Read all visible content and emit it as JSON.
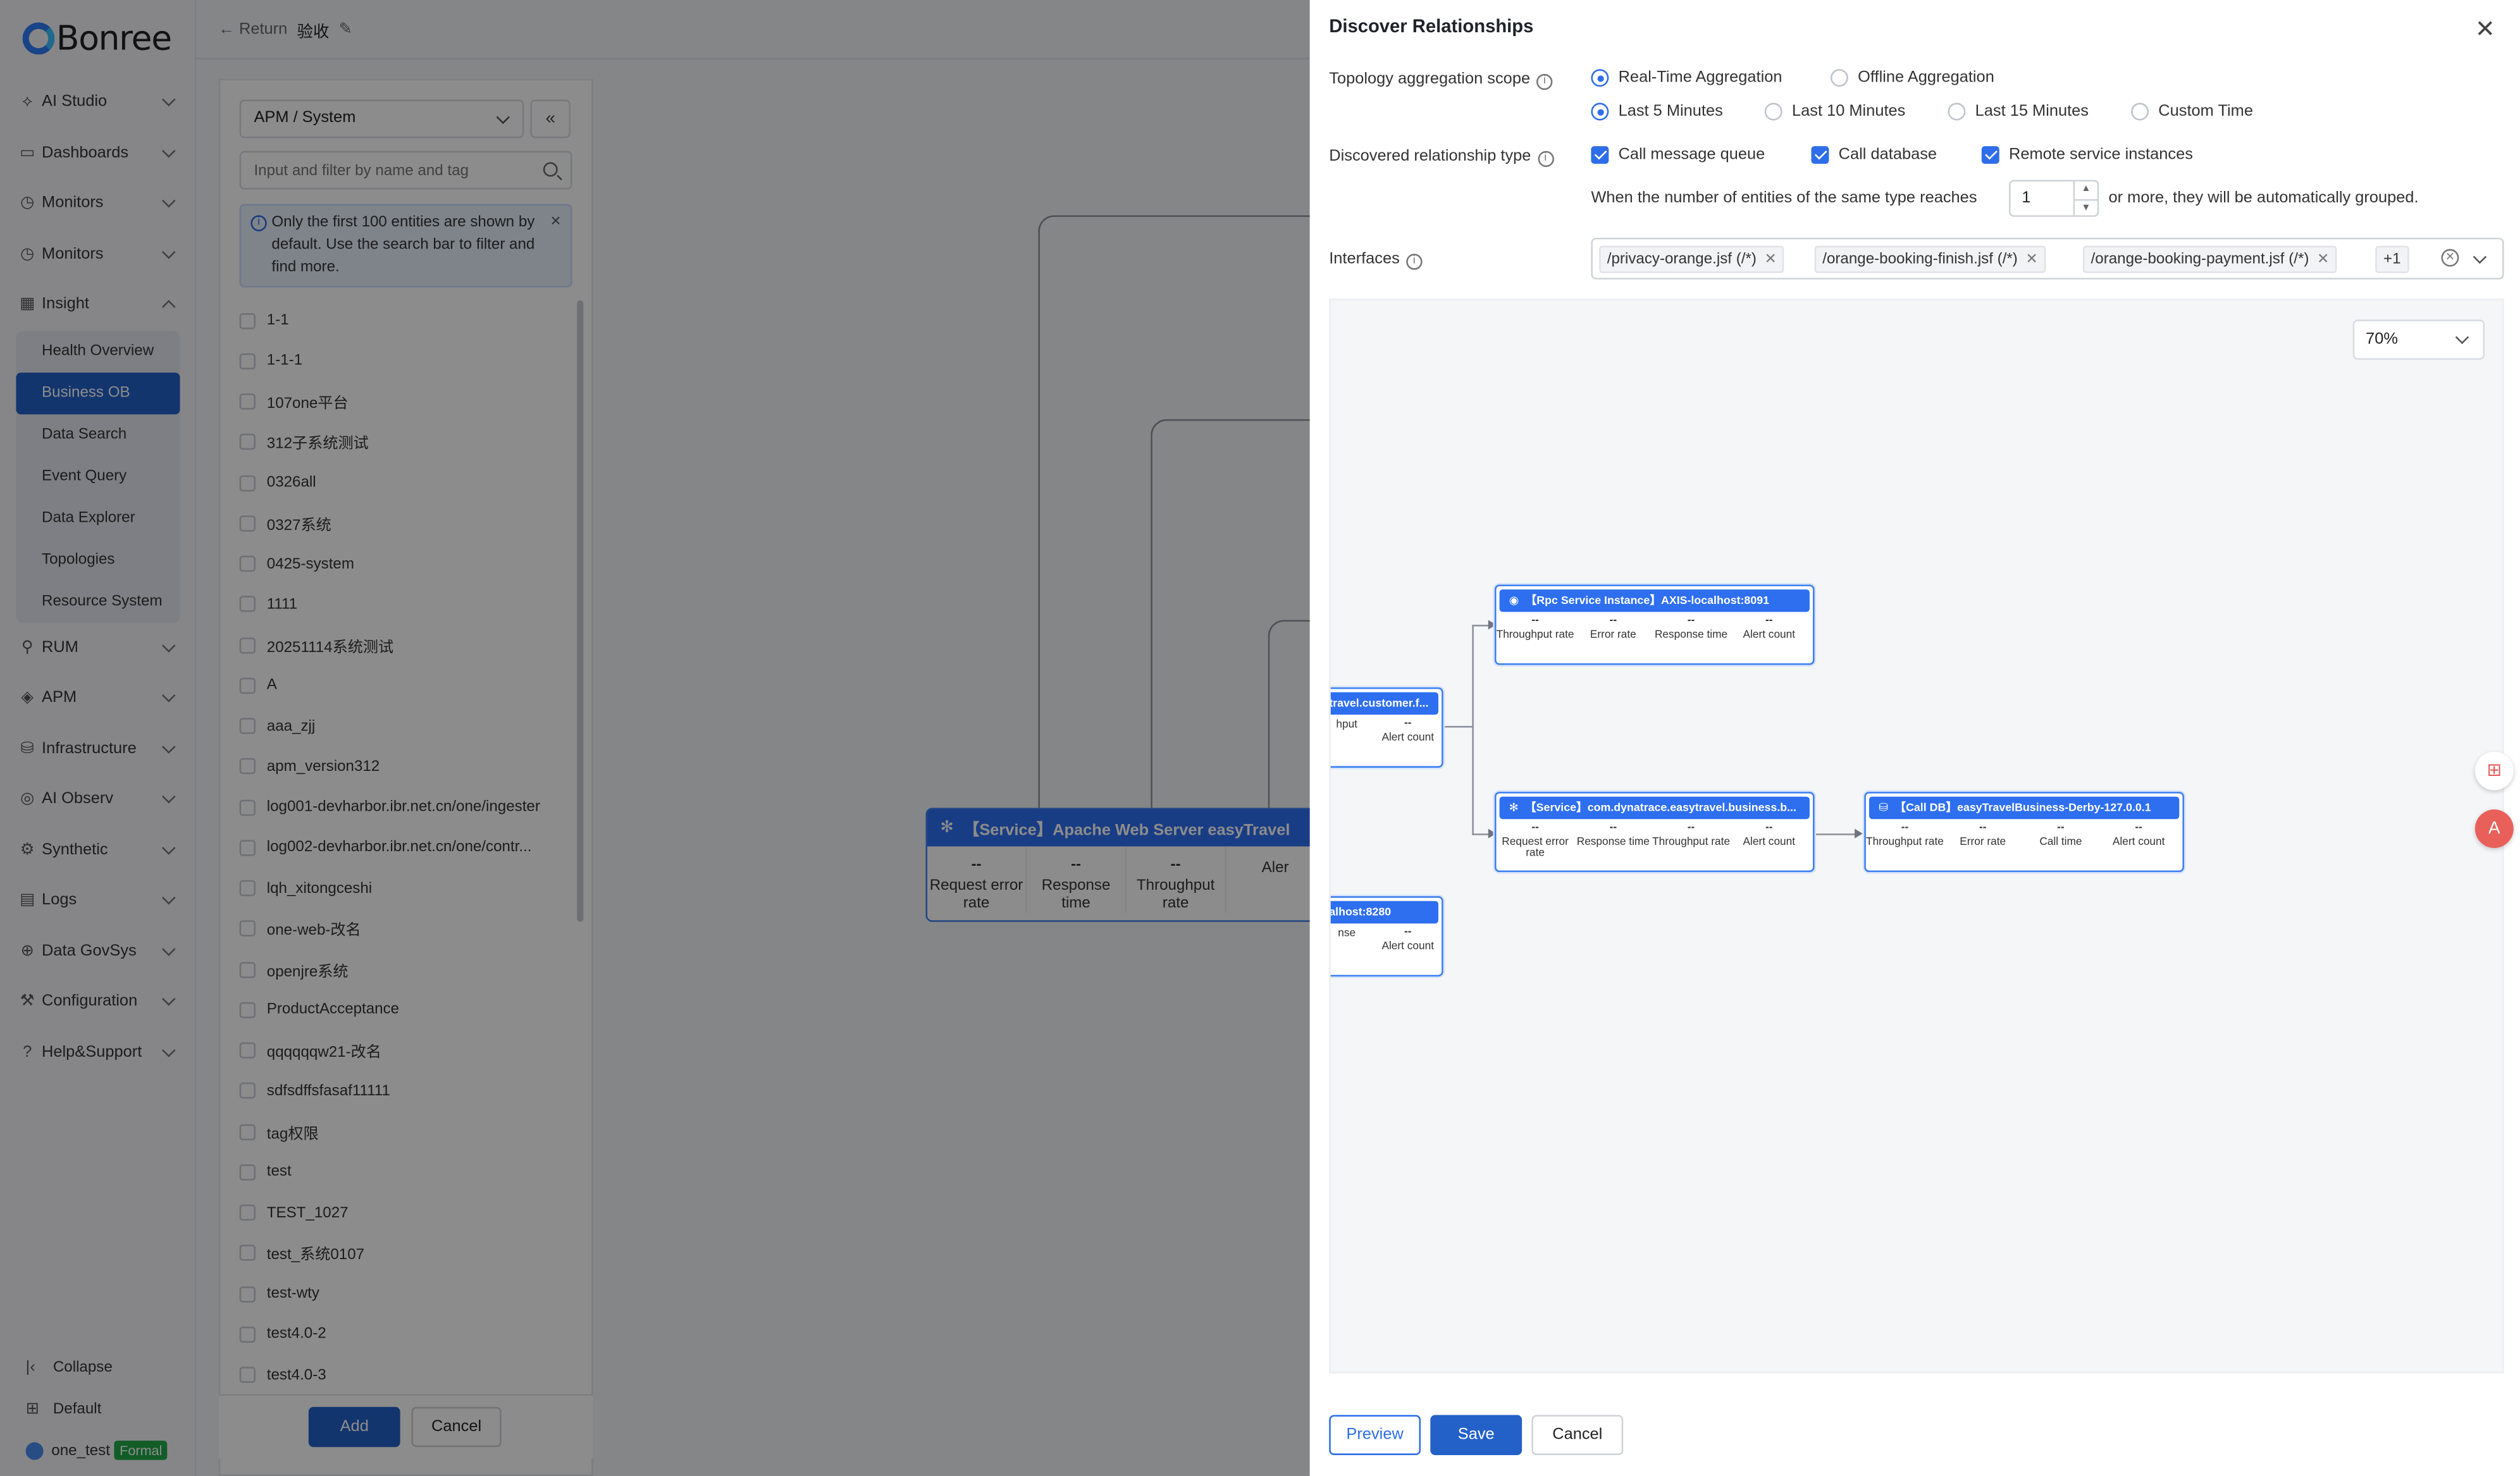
{
  "logo": {
    "text": "Bonree"
  },
  "sidebar": {
    "items": [
      {
        "label": "AI Studio",
        "icon": "ai-icon"
      },
      {
        "label": "Dashboards",
        "icon": "dashboard-icon"
      },
      {
        "label": "Monitors",
        "icon": "monitor-icon"
      },
      {
        "label": "Monitors",
        "icon": "monitor-icon"
      },
      {
        "label": "Insight",
        "icon": "insight-icon"
      }
    ],
    "insight_sub": [
      "Health Overview",
      "Business OB",
      "Data Search",
      "Event Query",
      "Data Explorer",
      "Topologies",
      "Resource System"
    ],
    "items_after": [
      {
        "label": "RUM",
        "icon": "rum-icon"
      },
      {
        "label": "APM",
        "icon": "apm-icon"
      },
      {
        "label": "Infrastructure",
        "icon": "infrastructure-icon"
      },
      {
        "label": "AI Observ",
        "icon": "ai-observ-icon"
      },
      {
        "label": "Synthetic",
        "icon": "synthetic-icon"
      },
      {
        "label": "Logs",
        "icon": "logs-icon"
      },
      {
        "label": "Data GovSys",
        "icon": "data-gov-icon"
      },
      {
        "label": "Configuration",
        "icon": "configuration-icon"
      },
      {
        "label": "Help&Support",
        "icon": "help-icon"
      }
    ],
    "collapse_label": "Collapse",
    "default_label": "Default",
    "user_name": "one_test",
    "user_badge": "Formal"
  },
  "topbar": {
    "return_label": "← Return",
    "title": "验收"
  },
  "left_panel": {
    "select_value": "APM / System",
    "search_placeholder": "Input and filter by name and tag",
    "info_text": "Only the first 100 entities are shown by default. Use the search bar to filter and find more.",
    "entities": [
      "1-1",
      "1-1-1",
      "107one平台",
      "312子系统测试",
      "0326all",
      "0327系统",
      "0425-system",
      "1111",
      "20251114系统测试",
      "A",
      "aaa_zjj",
      "apm_version312",
      "log001-devharbor.ibr.net.cn/one/ingester",
      "log002-devharbor.ibr.net.cn/one/contr...",
      "lqh_xitongceshi",
      "one-web-改名",
      "openjre系统",
      "ProductAcceptance",
      "qqqqqqw21-改名",
      "sdfsdffsfasaf11111",
      "tag权限",
      "test",
      "TEST_1027",
      "test_系统0107",
      "test-wty",
      "test4.0-2",
      "test4.0-3"
    ],
    "add_label": "Add",
    "cancel_label": "Cancel"
  },
  "bg_node": {
    "title": "【Service】Apache Web Server easyTravel",
    "cells": [
      {
        "value": "--",
        "label": "Request error rate"
      },
      {
        "value": "--",
        "label": "Response time"
      },
      {
        "value": "--",
        "label": "Throughput rate"
      },
      {
        "value": "",
        "label": "Aler"
      }
    ]
  },
  "drawer": {
    "title": "Discover Relationships",
    "scope_label": "Topology aggregation scope",
    "aggregation": [
      "Real-Time Aggregation",
      "Offline Aggregation"
    ],
    "aggregation_selected": 0,
    "time_ranges": [
      "Last 5 Minutes",
      "Last 10 Minutes",
      "Last 15 Minutes",
      "Custom Time"
    ],
    "time_selected": 0,
    "rel_type_label": "Discovered relationship type",
    "rel_types": [
      "Call message queue",
      "Call database",
      "Remote service instances"
    ],
    "group_text_before": "When the number of entities of the same type reaches",
    "group_value": "1",
    "group_text_after": "or more, they will be automatically grouped.",
    "interfaces_label": "Interfaces",
    "interfaces": [
      "/privacy-orange.jsf (/*)",
      "/orange-booking-finish.jsf (/*)",
      "/orange-booking-payment.jsf (/*)"
    ],
    "interfaces_more": "+1",
    "zoom": "70%",
    "preview_label": "Preview",
    "save_label": "Save",
    "cancel_label": "Cancel"
  },
  "topology": {
    "nodes": [
      {
        "name": "rpc-node",
        "title": "【Rpc Service Instance】AXIS-localhost:8091",
        "icon": "rpc-icon",
        "cells": [
          {
            "value": "--",
            "label": "Throughput rate"
          },
          {
            "value": "--",
            "label": "Error rate"
          },
          {
            "value": "--",
            "label": "Response time"
          },
          {
            "value": "--",
            "label": "Alert count"
          }
        ]
      },
      {
        "name": "service-node",
        "title": "【Service】com.dynatrace.easytravel.business.b...",
        "icon": "service-icon",
        "cells": [
          {
            "value": "--",
            "label": "Request error rate"
          },
          {
            "value": "--",
            "label": "Response time"
          },
          {
            "value": "--",
            "label": "Throughput rate"
          },
          {
            "value": "--",
            "label": "Alert count"
          }
        ]
      },
      {
        "name": "db-node",
        "title": "【Call DB】easyTravelBusiness-Derby-127.0.0.1",
        "icon": "database-icon",
        "cells": [
          {
            "value": "--",
            "label": "Throughput rate"
          },
          {
            "value": "--",
            "label": "Error rate"
          },
          {
            "value": "--",
            "label": "Call time"
          },
          {
            "value": "--",
            "label": "Alert count"
          }
        ]
      },
      {
        "name": "customer-node",
        "title": "travel.customer.f...",
        "icon": "",
        "cells": [
          {
            "value": "",
            "label": "hput"
          },
          {
            "value": "--",
            "label": "Alert count"
          }
        ]
      },
      {
        "name": "localhost-node",
        "title": "alhost:8280",
        "icon": "",
        "cells": [
          {
            "value": "",
            "label": "nse"
          },
          {
            "value": "--",
            "label": "Alert count"
          }
        ]
      }
    ]
  }
}
